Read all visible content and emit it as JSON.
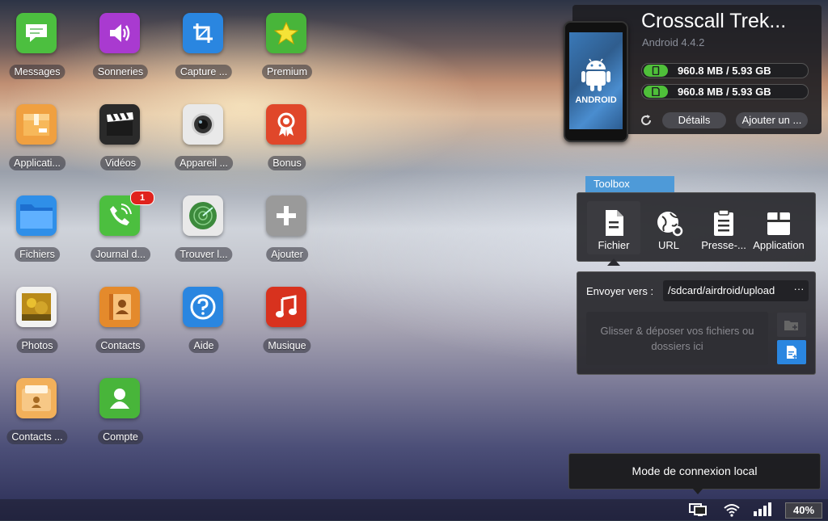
{
  "desktop": {
    "apps": [
      {
        "label": "Messages",
        "icon": "messages-icon",
        "color": "#4cbf3f"
      },
      {
        "label": "Sonneries",
        "icon": "ringtones-icon",
        "color": "#a93ad0"
      },
      {
        "label": "Capture ...",
        "icon": "crop-icon",
        "color": "#2a86e0"
      },
      {
        "label": "Premium",
        "icon": "star-icon",
        "color": "#48b53a"
      },
      {
        "label": "Applicati...",
        "icon": "apk-box-icon",
        "color": "#f0a040"
      },
      {
        "label": "Vidéos",
        "icon": "clapperboard-icon",
        "color": "#2a2a2a"
      },
      {
        "label": "Appareil ...",
        "icon": "camera-icon",
        "color": "#e9e9e9"
      },
      {
        "label": "Bonus",
        "icon": "award-icon",
        "color": "#e0472a"
      },
      {
        "label": "Fichiers",
        "icon": "folder-icon",
        "color": "#2f8fe8"
      },
      {
        "label": "Journal d...",
        "icon": "phone-icon",
        "color": "#4cbf3f",
        "badge": "1"
      },
      {
        "label": "Trouver l...",
        "icon": "radar-icon",
        "color": "#e9e9e9"
      },
      {
        "label": "Ajouter",
        "icon": "plus-icon",
        "color": "#9a9a9a"
      },
      {
        "label": "Photos",
        "icon": "photo-icon",
        "color": "#f2f2f2"
      },
      {
        "label": "Contacts",
        "icon": "contacts-book-icon",
        "color": "#e48a2c"
      },
      {
        "label": "Aide",
        "icon": "help-icon",
        "color": "#2a86e0"
      },
      {
        "label": "Musique",
        "icon": "music-icon",
        "color": "#d8321e"
      },
      {
        "label": "Contacts ...",
        "icon": "contacts-folder-icon",
        "color": "#f2b05a"
      },
      {
        "label": "Compte",
        "icon": "account-icon",
        "color": "#48b53a"
      }
    ]
  },
  "device": {
    "name": "Crosscall Trek...",
    "os": "Android 4.4.2",
    "phone_logo": "ANDROID",
    "storage_internal": "960.8 MB / 5.93 GB",
    "storage_sd": "960.8 MB / 5.93 GB",
    "details_label": "Détails",
    "add_label": "Ajouter un ..."
  },
  "toolbox": {
    "tab": "Toolbox",
    "tools": [
      {
        "label": "Fichier",
        "icon": "file-icon",
        "active": true
      },
      {
        "label": "URL",
        "icon": "globe-icon"
      },
      {
        "label": "Presse-...",
        "icon": "clipboard-icon"
      },
      {
        "label": "Application",
        "icon": "package-icon"
      }
    ],
    "send_label": "Envoyer vers :",
    "path": "/sdcard/airdroid/upload",
    "path_more": "···",
    "dropzone": "Glisser & déposer vos fichiers ou dossiers ici"
  },
  "tooltip": "Mode de connexion local",
  "status": {
    "battery": "40%"
  },
  "colors": {
    "accent": "#4e9ad8",
    "storage_green": "#4fc03a",
    "badge_red": "#e0231d",
    "button_blue": "#2a86e0"
  }
}
